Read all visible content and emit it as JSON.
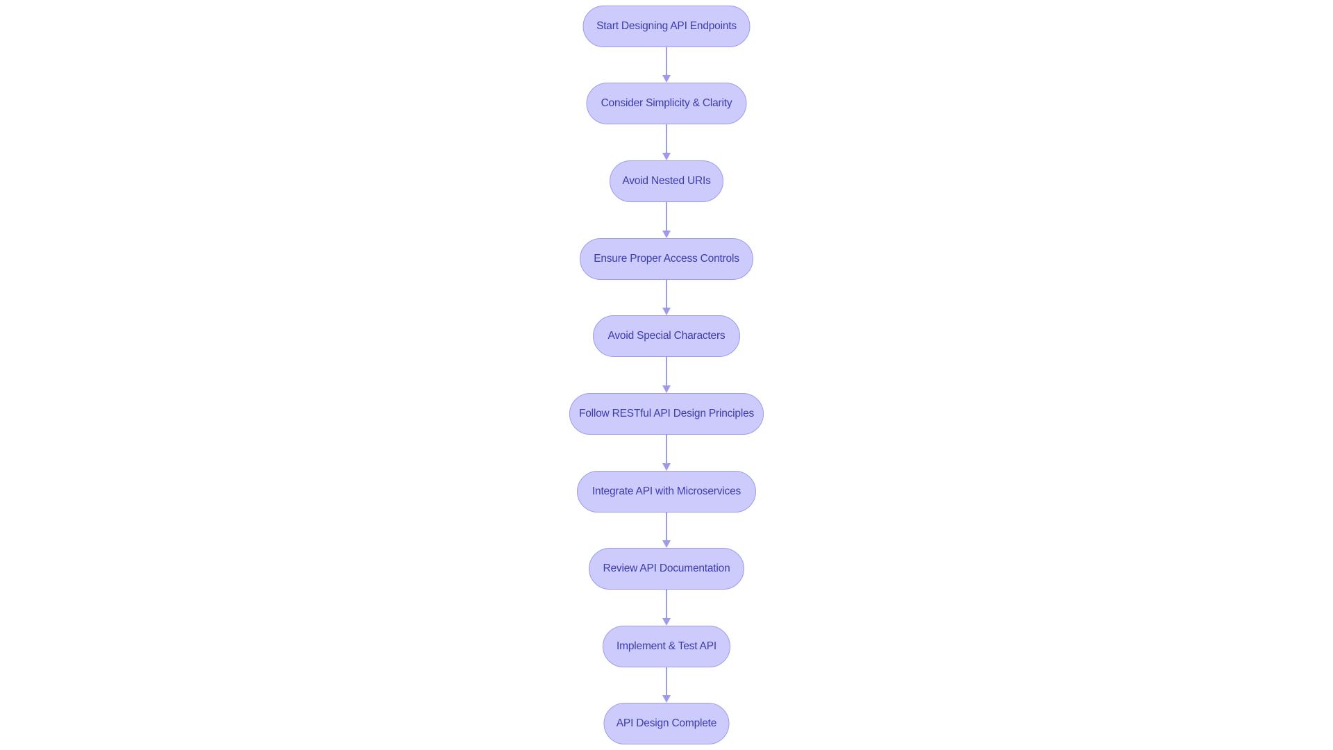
{
  "diagram": {
    "type": "flowchart",
    "direction": "top-to-bottom",
    "colors": {
      "node_fill": "#cccbfc",
      "node_border": "#9d9ceb",
      "node_text": "#3c3cad",
      "edge": "#9d9ceb",
      "background": "#ffffff"
    },
    "nodes": [
      {
        "id": "n1",
        "label": "Start Designing API Endpoints",
        "shape": "stadium"
      },
      {
        "id": "n2",
        "label": "Consider Simplicity & Clarity",
        "shape": "stadium"
      },
      {
        "id": "n3",
        "label": "Avoid Nested URIs",
        "shape": "stadium"
      },
      {
        "id": "n4",
        "label": "Ensure Proper Access Controls",
        "shape": "stadium"
      },
      {
        "id": "n5",
        "label": "Avoid Special Characters",
        "shape": "stadium"
      },
      {
        "id": "n6",
        "label": "Follow RESTful API Design Principles",
        "shape": "stadium"
      },
      {
        "id": "n7",
        "label": "Integrate API with Microservices",
        "shape": "stadium"
      },
      {
        "id": "n8",
        "label": "Review API Documentation",
        "shape": "stadium"
      },
      {
        "id": "n9",
        "label": "Implement & Test API",
        "shape": "stadium"
      },
      {
        "id": "n10",
        "label": "API Design Complete",
        "shape": "stadium"
      }
    ],
    "edges": [
      {
        "from": "n1",
        "to": "n2"
      },
      {
        "from": "n2",
        "to": "n3"
      },
      {
        "from": "n3",
        "to": "n4"
      },
      {
        "from": "n4",
        "to": "n5"
      },
      {
        "from": "n5",
        "to": "n6"
      },
      {
        "from": "n6",
        "to": "n7"
      },
      {
        "from": "n7",
        "to": "n8"
      },
      {
        "from": "n8",
        "to": "n9"
      },
      {
        "from": "n9",
        "to": "n10"
      }
    ]
  }
}
